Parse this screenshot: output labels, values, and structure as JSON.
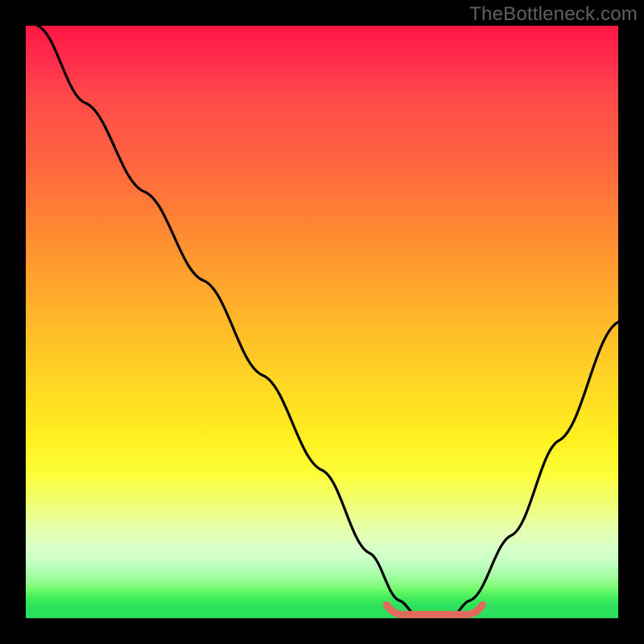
{
  "watermark": {
    "text": "TheBottleneck.com"
  },
  "colors": {
    "frame": "#000000",
    "gradient_top": "#ff1744",
    "gradient_mid": "#ffd624",
    "gradient_bottom": "#2cd85e",
    "curve": "#000000",
    "marker": "#e06a5c"
  },
  "chart_data": {
    "type": "line",
    "title": "",
    "xlabel": "",
    "ylabel": "",
    "xlim": [
      0,
      100
    ],
    "ylim": [
      0,
      100
    ],
    "curve_points": [
      {
        "x": 2,
        "y": 100
      },
      {
        "x": 10,
        "y": 87
      },
      {
        "x": 20,
        "y": 72
      },
      {
        "x": 30,
        "y": 57
      },
      {
        "x": 40,
        "y": 41
      },
      {
        "x": 50,
        "y": 25
      },
      {
        "x": 58,
        "y": 11
      },
      {
        "x": 63,
        "y": 3
      },
      {
        "x": 66,
        "y": 0.5
      },
      {
        "x": 72,
        "y": 0.5
      },
      {
        "x": 75,
        "y": 3
      },
      {
        "x": 82,
        "y": 14
      },
      {
        "x": 90,
        "y": 30
      },
      {
        "x": 100,
        "y": 50
      }
    ],
    "optimal_range": {
      "x_start": 62,
      "x_end": 76,
      "y": 0.5
    },
    "note": "V-shaped bottleneck curve over red-to-green vertical gradient; minimum (optimal) region near x≈62–76."
  }
}
